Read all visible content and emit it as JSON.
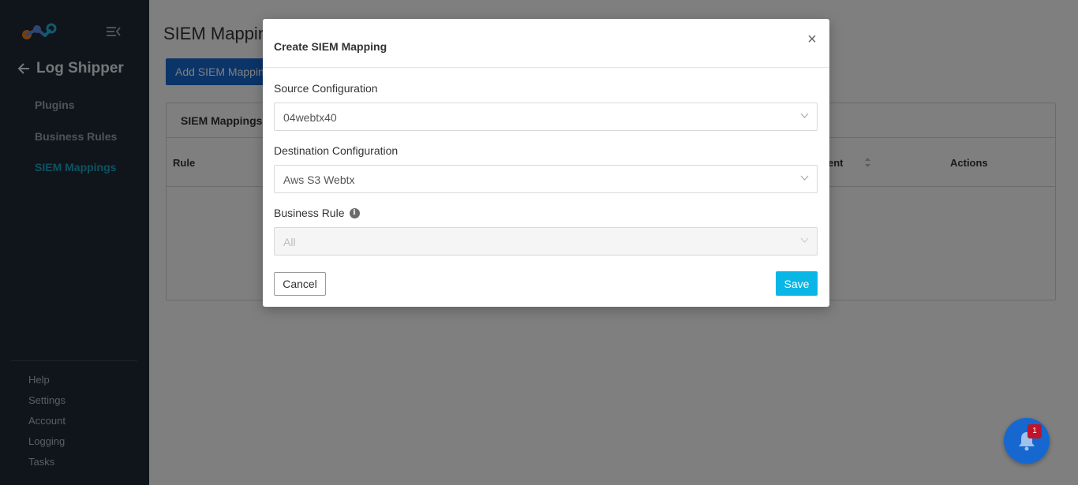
{
  "sidebar": {
    "back_title": "Log Shipper",
    "nav": [
      {
        "label": "Plugins",
        "active": false
      },
      {
        "label": "Business Rules",
        "active": false
      },
      {
        "label": "SIEM Mappings",
        "active": true
      }
    ],
    "bottom_links": [
      "Help",
      "Settings",
      "Account",
      "Logging",
      "Tasks"
    ]
  },
  "main": {
    "page_title": "SIEM Mappings",
    "add_button_label": "Add SIEM Mapping",
    "panel_title": "SIEM Mappings",
    "columns": {
      "rule": "Rule",
      "ent": "ent",
      "actions": "Actions"
    }
  },
  "modal": {
    "title": "Create SIEM Mapping",
    "close_label": "×",
    "source": {
      "label": "Source Configuration",
      "value": "04webtx40"
    },
    "destination": {
      "label": "Destination Configuration",
      "value": "Aws S3 Webtx"
    },
    "business_rule": {
      "label": "Business Rule",
      "value": "All",
      "disabled": true
    },
    "cancel_label": "Cancel",
    "save_label": "Save"
  },
  "notifications": {
    "badge_count": "1"
  },
  "colors": {
    "sidebar_bg": "#1e2a35",
    "accent": "#19a6c7",
    "primary_button": "#1668d0",
    "save_button": "#0ab6e6",
    "badge": "#c0142a"
  }
}
